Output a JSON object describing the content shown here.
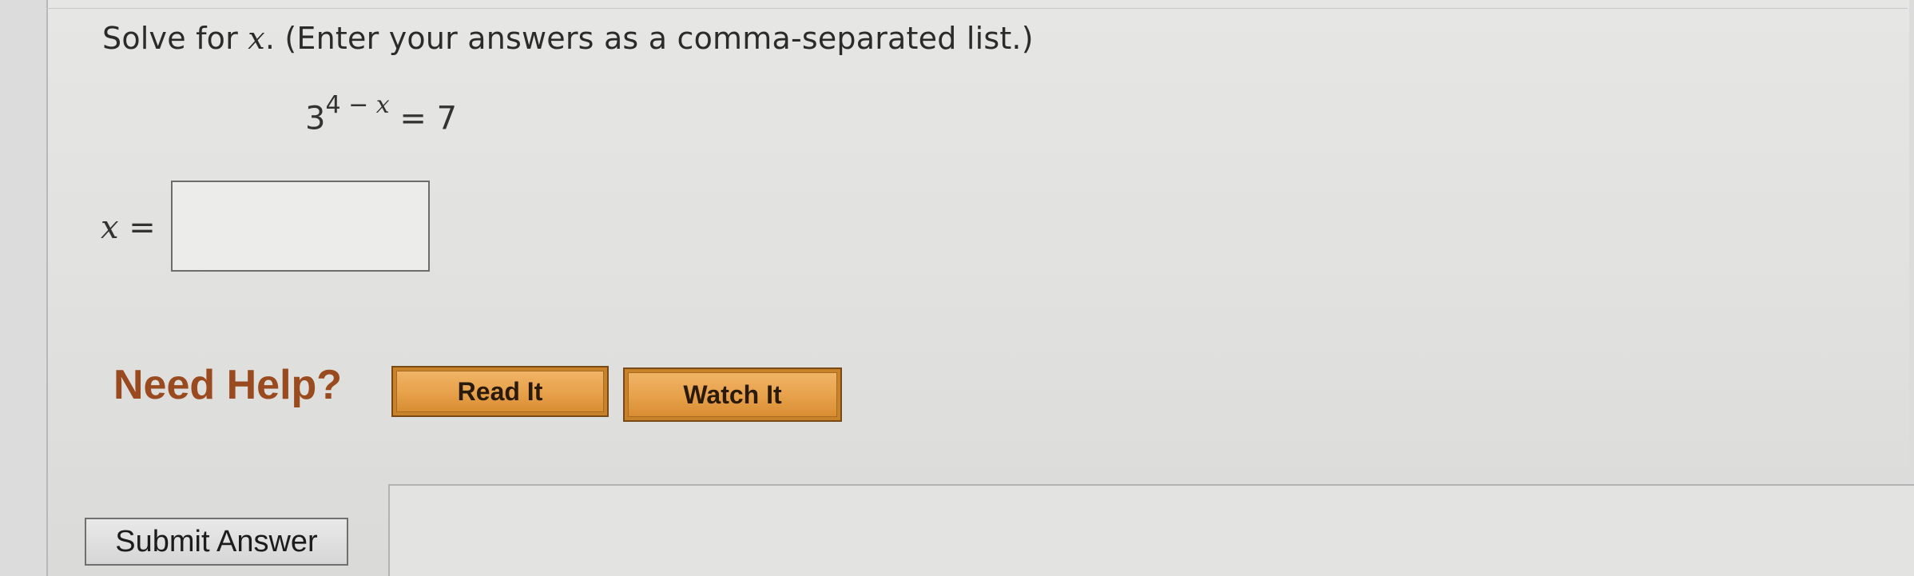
{
  "question": {
    "prompt_before": "Solve for ",
    "prompt_var": "x",
    "prompt_after": ". (Enter your answers as a comma-separated list.)",
    "equation_base": "3",
    "equation_exp_number": "4 − ",
    "equation_exp_var": "x",
    "equation_rhs": " = 7"
  },
  "answer": {
    "label_var": "x",
    "label_eq": " =",
    "value": ""
  },
  "help": {
    "label": "Need Help?",
    "read_it": "Read It",
    "watch_it": "Watch It"
  },
  "actions": {
    "submit": "Submit Answer"
  },
  "colors": {
    "help_label": "#9a4a1f",
    "help_button": "#e7a14a",
    "background": "#e3e3e1"
  }
}
